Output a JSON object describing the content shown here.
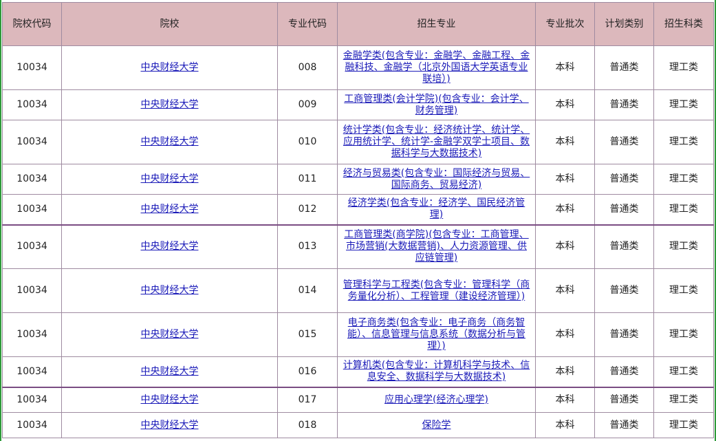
{
  "headers": [
    "院校代码",
    "院校",
    "专业代码",
    "招生专业",
    "专业批次",
    "计划类别",
    "招生科类"
  ],
  "rows": [
    {
      "code": "10034",
      "school": "中央财经大学",
      "major_code": "008",
      "major": "金融学类(包含专业：金融学、金融工程、金融科技、金融学（北京外国语大学英语专业联培）)",
      "batch": "本科",
      "plan": "普通类",
      "category": "理工类"
    },
    {
      "code": "10034",
      "school": "中央财经大学",
      "major_code": "009",
      "major": "工商管理类(会计学院)(包含专业：会计学、财务管理)",
      "batch": "本科",
      "plan": "普通类",
      "category": "理工类"
    },
    {
      "code": "10034",
      "school": "中央财经大学",
      "major_code": "010",
      "major": "统计学类(包含专业：经济统计学、统计学、应用统计学、统计学-金融学双学士项目、数据科学与大数据技术)",
      "batch": "本科",
      "plan": "普通类",
      "category": "理工类"
    },
    {
      "code": "10034",
      "school": "中央财经大学",
      "major_code": "011",
      "major": "经济与贸易类(包含专业：国际经济与贸易、国际商务、贸易经济)",
      "batch": "本科",
      "plan": "普通类",
      "category": "理工类"
    },
    {
      "code": "10034",
      "school": "中央财经大学",
      "major_code": "012",
      "major": "经济学类(包含专业：经济学、国民经济管理)",
      "batch": "本科",
      "plan": "普通类",
      "category": "理工类"
    },
    {
      "code": "10034",
      "school": "中央财经大学",
      "major_code": "013",
      "major": "工商管理类(商学院)(包含专业：工商管理、市场营销(大数据营销)、人力资源管理、供应链管理)",
      "batch": "本科",
      "plan": "普通类",
      "category": "理工类"
    },
    {
      "code": "10034",
      "school": "中央财经大学",
      "major_code": "014",
      "major": "管理科学与工程类(包含专业：管理科学（商务量化分析）、工程管理（建设经济管理）)",
      "batch": "本科",
      "plan": "普通类",
      "category": "理工类"
    },
    {
      "code": "10034",
      "school": "中央财经大学",
      "major_code": "015",
      "major": "电子商务类(包含专业：电子商务（商务智能）、信息管理与信息系统（数据分析与管理）)",
      "batch": "本科",
      "plan": "普通类",
      "category": "理工类"
    },
    {
      "code": "10034",
      "school": "中央财经大学",
      "major_code": "016",
      "major": "计算机类(包含专业：计算机科学与技术、信息安全、数据科学与大数据技术)",
      "batch": "本科",
      "plan": "普通类",
      "category": "理工类"
    },
    {
      "code": "10034",
      "school": "中央财经大学",
      "major_code": "017",
      "major": "应用心理学(经济心理学)",
      "batch": "本科",
      "plan": "普通类",
      "category": "理工类"
    },
    {
      "code": "10034",
      "school": "中央财经大学",
      "major_code": "018",
      "major": "保险学",
      "batch": "本科",
      "plan": "普通类",
      "category": "理工类"
    }
  ],
  "colors": {
    "header_bg": "#dcb8bc",
    "border": "#9e8aa0",
    "separator": "#7a4c82",
    "link": "#1a1ab8",
    "page_edge": "#2e9a3a"
  }
}
